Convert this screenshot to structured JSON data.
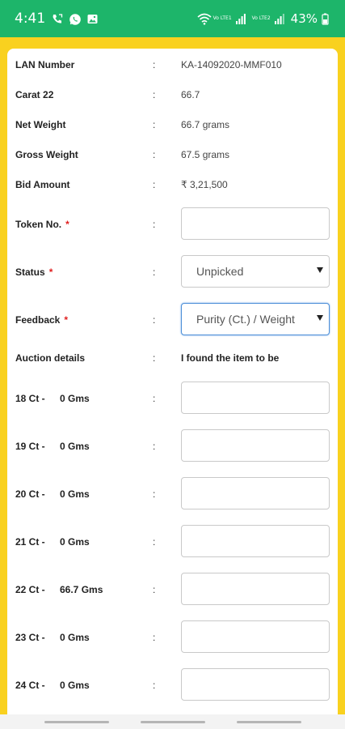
{
  "status_bar": {
    "time": "4:41",
    "left_icons": [
      "call-forward-icon",
      "whatsapp-icon",
      "image-icon"
    ],
    "network1": "Vo LTE1",
    "network2": "Vo LTE2",
    "battery": "43%"
  },
  "details": [
    {
      "label": "LAN Number",
      "colon": ":",
      "value": "KA-14092020-MMF010"
    },
    {
      "label": "Carat 22",
      "colon": ":",
      "value": "66.7"
    },
    {
      "label": "Net Weight",
      "colon": ":",
      "value": "66.7 grams"
    },
    {
      "label": "Gross Weight",
      "colon": ":",
      "value": "67.5 grams"
    },
    {
      "label": "Bid Amount",
      "colon": ":",
      "value": "₹ 3,21,500"
    }
  ],
  "token": {
    "label": "Token No.",
    "required": "*",
    "colon": ":",
    "value": ""
  },
  "status": {
    "label": "Status",
    "required": "*",
    "colon": ":",
    "selected": "Unpicked"
  },
  "feedback": {
    "label": "Feedback",
    "required": "*",
    "colon": ":",
    "selected": "Purity (Ct.) / Weight"
  },
  "auction": {
    "label": "Auction details",
    "colon": ":",
    "value": "I found the item to be"
  },
  "carats": [
    {
      "label": "18 Ct -",
      "gms": "0 Gms",
      "colon": ":",
      "input": ""
    },
    {
      "label": "19 Ct -",
      "gms": "0 Gms",
      "colon": ":",
      "input": ""
    },
    {
      "label": "20 Ct -",
      "gms": "0 Gms",
      "colon": ":",
      "input": ""
    },
    {
      "label": "21 Ct -",
      "gms": "0 Gms",
      "colon": ":",
      "input": ""
    },
    {
      "label": "22 Ct -",
      "gms": "66.7 Gms",
      "colon": ":",
      "input": ""
    },
    {
      "label": "23 Ct -",
      "gms": "0 Gms",
      "colon": ":",
      "input": ""
    },
    {
      "label": "24 Ct -",
      "gms": "0 Gms",
      "colon": ":",
      "input": ""
    }
  ],
  "colors": {
    "header_green": "#1db56a",
    "background_yellow": "#f9d11f",
    "required_red": "#e02020",
    "focus_blue": "#4d8fd8"
  }
}
